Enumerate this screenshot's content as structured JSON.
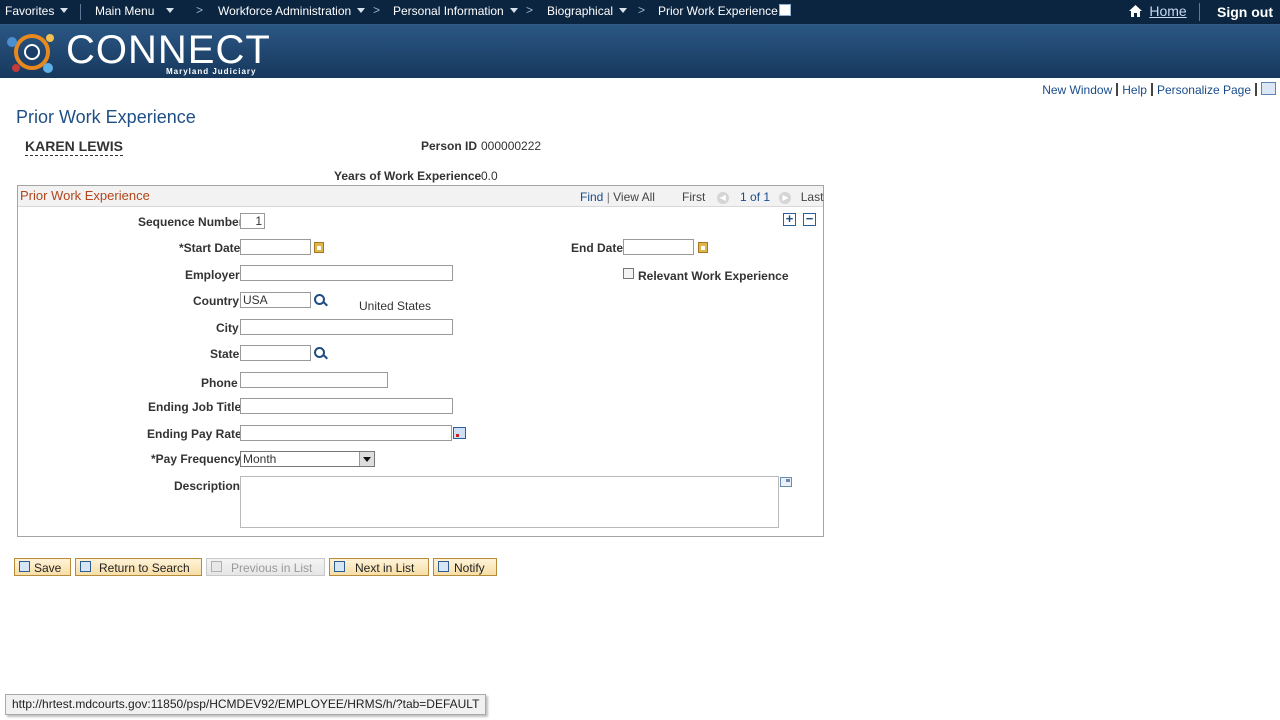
{
  "nav": {
    "favorites": "Favorites",
    "main_menu": "Main Menu",
    "crumb_sep": ">",
    "breadcrumbs": [
      "Workforce Administration",
      "Personal Information",
      "Biographical",
      "Prior Work Experience"
    ],
    "home": "Home",
    "sign_out": "Sign out"
  },
  "logo": {
    "title": "CONNECT",
    "subtitle": "Maryland Judiciary"
  },
  "toplinks": {
    "new_window": "New Window",
    "help": "Help",
    "personalize": "Personalize Page"
  },
  "page": {
    "title": "Prior Work Experience",
    "employee_name": "KAREN LEWIS",
    "person_id_label": "Person ID",
    "person_id": "000000222",
    "years_label": "Years of Work Experience",
    "years": "0.0"
  },
  "group": {
    "title": "Prior Work Experience",
    "find": "Find",
    "view_all": "View All",
    "first": "First",
    "position": "1 of 1",
    "last": "Last",
    "add_symbol": "+",
    "delete_symbol": "−"
  },
  "form": {
    "sequence_label": "Sequence Number",
    "sequence_value": "1",
    "start_date_label": "*Start Date",
    "start_date": "",
    "end_date_label": "End Date",
    "end_date": "",
    "employer_label": "Employer",
    "employer": "",
    "relevant_label": "Relevant Work Experience",
    "relevant_checked": false,
    "country_label": "Country",
    "country_code": "USA",
    "country_name": "United States",
    "city_label": "City",
    "city": "",
    "state_label": "State",
    "state": "",
    "phone_label": "Phone",
    "phone": "",
    "job_title_label": "Ending Job Title",
    "job_title": "",
    "pay_rate_label": "Ending Pay Rate",
    "pay_rate": "",
    "pay_freq_label": "*Pay Frequency",
    "pay_freq": "Month",
    "description_label": "Description",
    "description": ""
  },
  "buttons": {
    "save": "Save",
    "return": "Return to Search",
    "previous": "Previous in List",
    "next": "Next in List",
    "notify": "Notify"
  },
  "status_url": "http://hrtest.mdcourts.gov:11850/psp/HCMDEV92/EMPLOYEE/HRMS/h/?tab=DEFAULT"
}
